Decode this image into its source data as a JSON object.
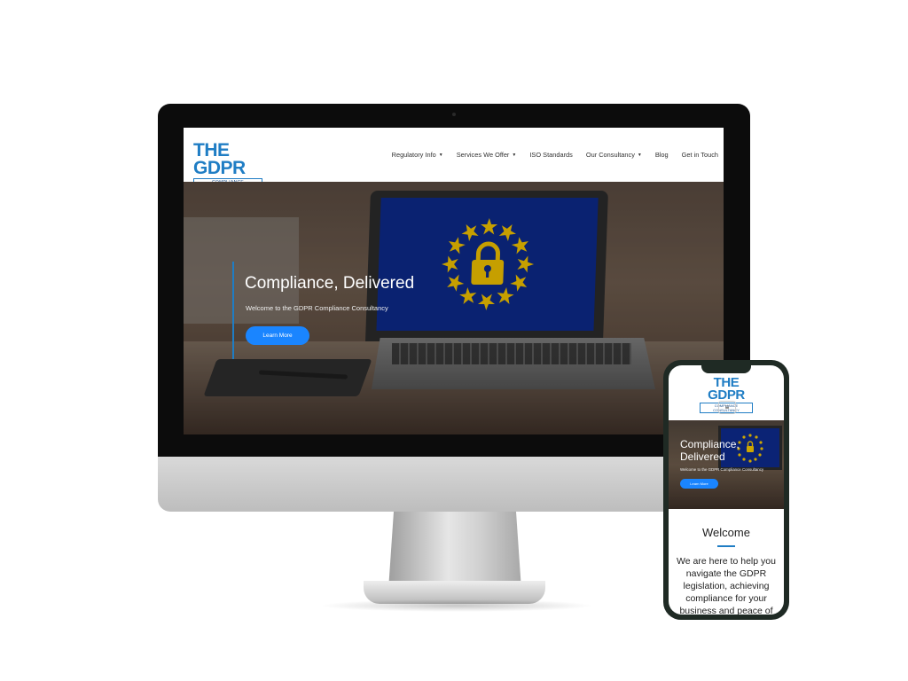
{
  "desktop": {
    "logo": {
      "main": "THE GDPR",
      "sub": "COMPLIANCE CONSULTANCY"
    },
    "nav": [
      {
        "label": "Regulatory Info",
        "dropdown": true
      },
      {
        "label": "Services We Offer",
        "dropdown": true
      },
      {
        "label": "ISO Standards",
        "dropdown": false
      },
      {
        "label": "Our Consultancy",
        "dropdown": true
      },
      {
        "label": "Blog",
        "dropdown": false
      },
      {
        "label": "Get in Touch",
        "dropdown": false
      }
    ],
    "hero": {
      "title": "Compliance, Delivered",
      "subtitle": "Welcome to the GDPR Compliance Consultancy",
      "button": "Learn More"
    }
  },
  "mobile": {
    "logo": {
      "main": "THE GDPR",
      "sub": "COMPLIANCE CONSULTANCY"
    },
    "menu_icon": "hamburger-icon",
    "hero": {
      "title": "Compliance, Delivered",
      "subtitle": "Welcome to the GDPR Compliance Consultancy",
      "button": "Learn More"
    },
    "welcome": {
      "title": "Welcome",
      "text": "We are here to help you navigate the GDPR legislation, achieving compliance for your business and peace of"
    }
  },
  "colors": {
    "brand_blue": "#1f7dc4",
    "button_blue": "#1a85ff",
    "eu_blue": "#0d2a8a",
    "eu_gold": "#f2c300"
  }
}
